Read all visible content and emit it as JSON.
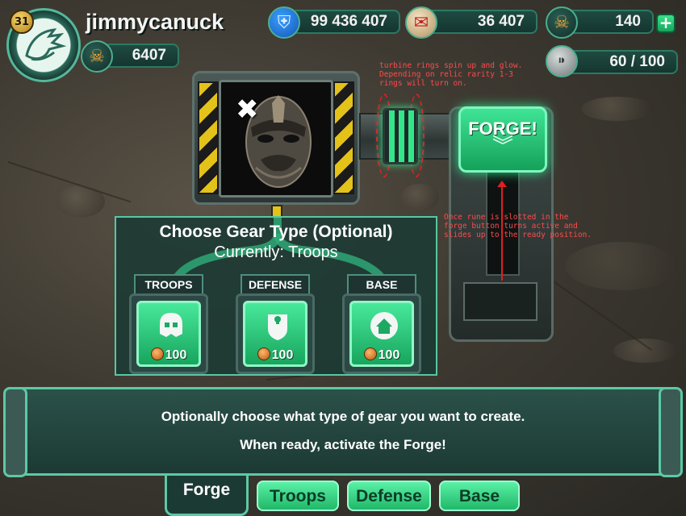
{
  "player": {
    "level": "31",
    "username": "jimmycanuck",
    "skulls": "6407"
  },
  "resources": {
    "troops_count": "99 436 407",
    "scrolls": "36 407",
    "coins": "140",
    "ammo": "60 / 100"
  },
  "notes": {
    "turbine": "turbine rings spin up and glow.\nDepending on relic rarity 1-3\nrings will turn on.",
    "rune": "Once rune is slotted in the\nforge button turns active and\nslides up to the ready position."
  },
  "forge_button": {
    "label": "FORGE!"
  },
  "gear_panel": {
    "title": "Choose Gear Type (Optional)",
    "current": "Currently: Troops",
    "options": [
      {
        "label": "TROOPS",
        "cost": "100",
        "icon": "helmet-icon"
      },
      {
        "label": "DEFENSE",
        "cost": "100",
        "icon": "shield-skull-icon"
      },
      {
        "label": "BASE",
        "cost": "100",
        "icon": "house-icon"
      }
    ]
  },
  "message": {
    "line1": "Optionally choose what type of gear you want to create.",
    "line2": "When ready, activate the Forge!"
  },
  "tabs": [
    {
      "label": "Forge",
      "active": true
    },
    {
      "label": "Troops",
      "active": false
    },
    {
      "label": "Defense",
      "active": false
    },
    {
      "label": "Base",
      "active": false
    }
  ],
  "colors": {
    "accent_green": "#2ee08a",
    "panel_teal": "#1c3a34",
    "annotation_red": "#e02020"
  }
}
